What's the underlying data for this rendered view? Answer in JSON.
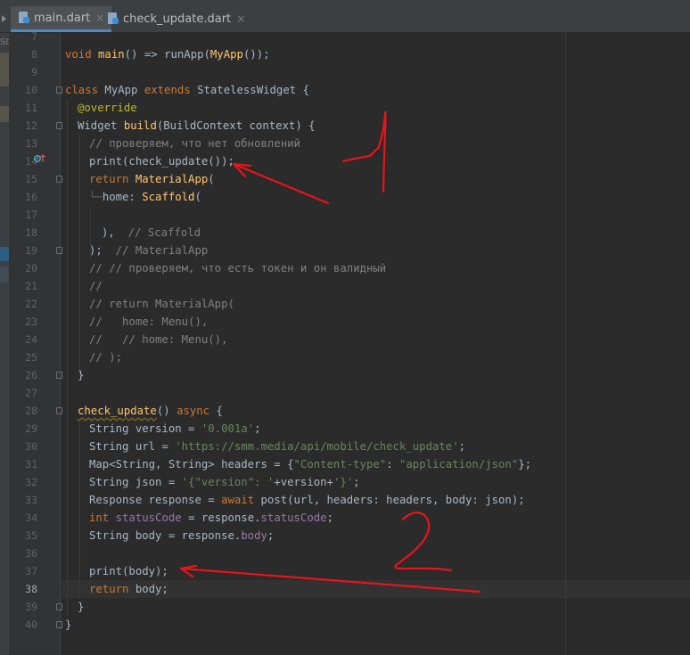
{
  "tabs": [
    {
      "label": "main.dart",
      "active": true
    },
    {
      "label": "check_update.dart",
      "active": false
    }
  ],
  "tab_close_glyph": "×",
  "cut_sidebar_text": "St",
  "current_line": "38",
  "colors": {
    "keyword": "#cc7832",
    "function": "#ffc66d",
    "string": "#6a8759",
    "comment": "#808080",
    "annotation": "#bbb529",
    "field": "#9876aa",
    "default_text": "#a9b7c6",
    "annotation_ink": "#e8141b"
  },
  "line_numbers": [
    "7",
    "8",
    "9",
    "10",
    "11",
    "12",
    "13",
    "14",
    "15",
    "16",
    "17",
    "18",
    "19",
    "20",
    "21",
    "22",
    "23",
    "24",
    "25",
    "26",
    "27",
    "28",
    "29",
    "30",
    "31",
    "32",
    "33",
    "34",
    "35",
    "36",
    "37",
    "38",
    "39",
    "40"
  ],
  "code": {
    "l8": {
      "a": "void ",
      "b": "main",
      "c": "() => runApp(",
      "d": "MyApp",
      "e": "());"
    },
    "l10": {
      "a": "class ",
      "b": "MyApp ",
      "c": "extends ",
      "d": "StatelessWidget {"
    },
    "l11": {
      "a": "@override"
    },
    "l12": {
      "a": "Widget ",
      "b": "build",
      "c": "(BuildContext context) {"
    },
    "l13": {
      "a": "// проверяем, что нет обновлений"
    },
    "l14": {
      "a": "print(check_update());"
    },
    "l15": {
      "a": "return ",
      "b": "MaterialApp",
      "c": "("
    },
    "l16": {
      "a": "home: ",
      "b": "Scaffold",
      "c": "("
    },
    "l18": {
      "a": "),  ",
      "b": "// Scaffold"
    },
    "l19": {
      "a": ");  ",
      "b": "// MaterialApp"
    },
    "l20": {
      "a": "// // проверяем, что есть токен и он валидный"
    },
    "l21": {
      "a": "//"
    },
    "l22": {
      "a": "// return MaterialApp("
    },
    "l23": {
      "a": "//   home: Menu(),"
    },
    "l24": {
      "a": "//   // home: Menu(),"
    },
    "l25": {
      "a": "// );"
    },
    "l26": {
      "a": "}"
    },
    "l28": {
      "a": "check_update",
      "b": "() ",
      "c": "async ",
      "d": "{"
    },
    "l29": {
      "a": "String version = ",
      "b": "'0.001a'",
      "c": ";"
    },
    "l30": {
      "a": "String url = ",
      "b": "'https://smm.media/api/mobile/check_update'",
      "c": ";"
    },
    "l31": {
      "a": "Map<String, String> headers = {",
      "b": "\"Content-type\"",
      "c": ": ",
      "d": "\"application/json\"",
      "e": "};"
    },
    "l32": {
      "a": "String json = ",
      "b": "'{\"version\": '",
      "c": "+version+",
      "d": "'}'",
      "e": ";"
    },
    "l33": {
      "a": "Response response = ",
      "b": "await ",
      "c": "post(url, headers: headers, body: json);"
    },
    "l34": {
      "a": "int ",
      "b": "statusCode",
      "c": " = response.",
      "d": "statusCode",
      "e": ";"
    },
    "l35": {
      "a": "String body = response.",
      "b": "body",
      "c": ";"
    },
    "l37": {
      "a": "print(body);"
    },
    "l38": {
      "a": "return ",
      "b": "body;"
    },
    "l39": {
      "a": "}"
    },
    "l40": {
      "a": "}"
    }
  },
  "handwritten_annotations": [
    "1",
    "2"
  ]
}
